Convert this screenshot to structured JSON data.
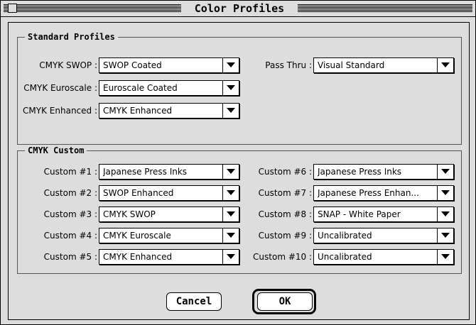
{
  "window": {
    "title": "Color Profiles"
  },
  "standard": {
    "title": "Standard Profiles",
    "rows": [
      {
        "label": "CMYK SWOP :",
        "value": "SWOP Coated"
      },
      {
        "label": "CMYK Euroscale :",
        "value": "Euroscale Coated"
      },
      {
        "label": "CMYK Enhanced :",
        "value": "CMYK Enhanced"
      }
    ],
    "pass_thru": {
      "label": "Pass Thru :",
      "value": "Visual Standard"
    }
  },
  "custom": {
    "title": "CMYK Custom",
    "left": [
      {
        "label": "Custom #1 :",
        "value": "Japanese Press Inks"
      },
      {
        "label": "Custom #2 :",
        "value": "SWOP Enhanced"
      },
      {
        "label": "Custom #3 :",
        "value": "CMYK SWOP"
      },
      {
        "label": "Custom #4 :",
        "value": "CMYK Euroscale"
      },
      {
        "label": "Custom #5 :",
        "value": "CMYK Enhanced"
      }
    ],
    "right": [
      {
        "label": "Custom #6 :",
        "value": "Japanese Press Inks"
      },
      {
        "label": "Custom #7 :",
        "value": "Japanese Press Enhan..."
      },
      {
        "label": "Custom #8 :",
        "value": "SNAP - White Paper"
      },
      {
        "label": "Custom #9 :",
        "value": "Uncalibrated"
      },
      {
        "label": "Custom #10 :",
        "value": "Uncalibrated"
      }
    ]
  },
  "buttons": {
    "cancel": "Cancel",
    "ok": "OK"
  }
}
